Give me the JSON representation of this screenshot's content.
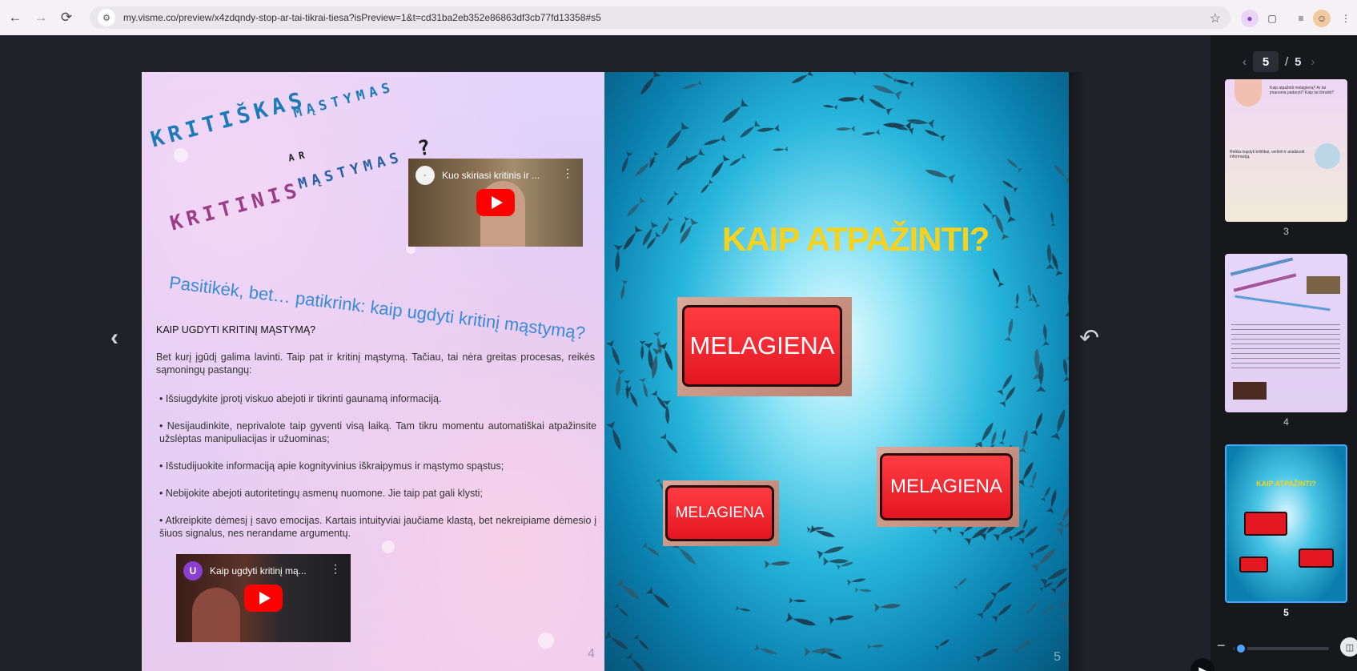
{
  "browser": {
    "url": "my.visme.co/preview/x4zdqndy-stop-ar-tai-tikrai-tiesa?isPreview=1&t=cd31ba2eb352e86863df3cb77fd13358#s5",
    "back_icon": "arrow-left-icon",
    "forward_icon": "arrow-right-icon",
    "reload_icon": "reload-icon",
    "site_info_icon": "tune-icon",
    "bookmark_icon": "star-icon"
  },
  "viewer": {
    "prev_icon": "chevron-left-icon",
    "back_icon": "undo-arrow-icon",
    "current_page": "5",
    "separator": "/",
    "total_pages": "5"
  },
  "page4": {
    "title_word1": "KRITIŠKAS",
    "title_word2": "MĄSTYMAS",
    "title_ar": "AR",
    "title_word3": "KRITINIS",
    "title_word4": "MĄSTYMAS",
    "title_q": "?",
    "subtitle": "Pasitikėk, bet… patikrink: kaip ugdyti kritinį mąstymą?",
    "heading": "KAIP UGDYTI KRITINĮ MĄSTYMĄ?",
    "intro": "Bet kurį įgūdį galima lavinti. Taip pat ir kritinį mąstymą. Tačiau, tai nėra greitas procesas, reikės sąmoningų pastangų:",
    "tips": [
      "• Išsiugdykite įprotį viskuo abejoti ir tikrinti gaunamą informaciją.",
      "• Nesijaudinkite, neprivalote taip gyventi visą laiką. Tam tikru momentu automatiškai atpažinsite užslėptas manipuliacijas ir užuominas;",
      "• Išstudijuokite informaciją apie kognityvinius iškraipymus ir mąstymo spąstus;",
      "• Nebijokite abejoti autoritetingų asmenų nuomone. Jie taip pat gali klysti;",
      "• Atkreipkite dėmesį į savo emocijas. Kartais intuityviai jaučiame klastą, bet nekreipiame dėmesio į šiuos signalus, nes nerandame argumentų."
    ],
    "video1_title": "Kuo skiriasi kritinis ir ...",
    "video2_title": "Kaip ugdyti kritinį mą...",
    "video2_avatar": "U",
    "page_number": "4"
  },
  "page5": {
    "title": "KAIP ATPAŽINTI?",
    "label1": "MELAGIENA",
    "label2": "MELAGIENA",
    "label3": "MELAGIENA",
    "page_number": "5"
  },
  "sidebar": {
    "thumb3_text1": "Kaip atpažinti melagieną? Ar tai įmanoma padaryti? Kaip tai išmokti?",
    "thumb3_text2": "Reikia mąstyti kritiškai, vertinti ir analizuoti informaciją.",
    "thumb3_label": "3",
    "thumb4_label": "4",
    "thumb5_title": "KAIP ATPAŽINTI?",
    "thumb5_label": "5",
    "zoom_minus": "−"
  },
  "colors": {
    "accent_blue": "#4aa7ff",
    "title_yellow": "#f7d21c",
    "melagiena_red": "#e31622",
    "youtube_red": "#ff0000"
  }
}
